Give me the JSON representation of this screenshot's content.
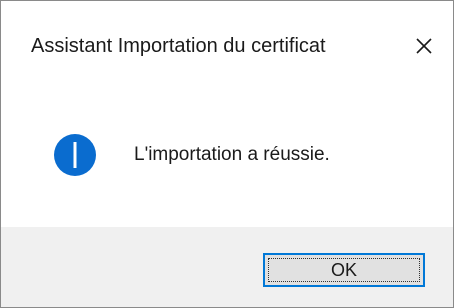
{
  "dialog": {
    "title": "Assistant Importation du certificat",
    "close_glyph": "✕",
    "message": "L'importation a réussie.",
    "icon": "info-icon",
    "ok_label": "OK"
  },
  "colors": {
    "info_icon": "#0a6ccf",
    "accent_border": "#0078d7",
    "footer_bg": "#f0f0f0",
    "button_bg": "#e1e1e1"
  }
}
